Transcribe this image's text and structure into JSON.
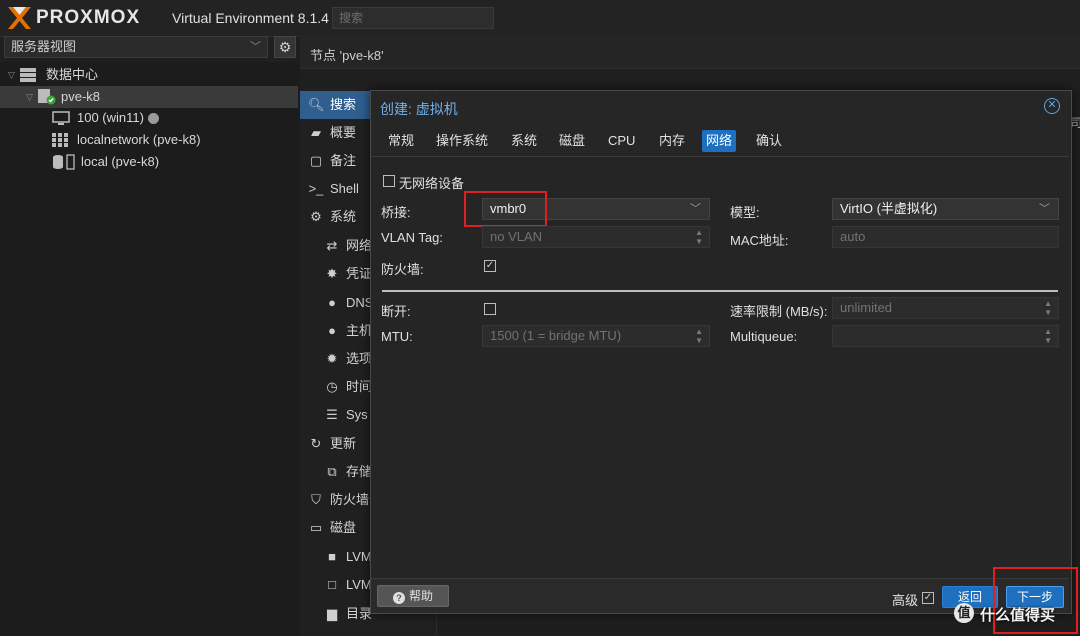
{
  "topbar": {
    "logo_text": "PROXMOX",
    "product": "Virtual Environment 8.1.4",
    "search_placeholder": "搜索"
  },
  "tree": {
    "view_select": "服务器视图",
    "items": [
      {
        "label": "数据中心"
      },
      {
        "label": "pve-k8"
      },
      {
        "label": "100 (win11)"
      },
      {
        "label": "localnetwork (pve-k8)"
      },
      {
        "label": "local (pve-k8)"
      }
    ]
  },
  "main": {
    "node_title": "节点 'pve-k8'",
    "right_edge_text": "司"
  },
  "node_nav": [
    {
      "label": "搜索",
      "icon": "search-icon"
    },
    {
      "label": "概要",
      "icon": "book-icon"
    },
    {
      "label": "备注",
      "icon": "note-icon"
    },
    {
      "label": "Shell",
      "icon": "terminal-icon"
    },
    {
      "label": "系统",
      "icon": "gears-icon"
    },
    {
      "label": "网络",
      "icon": "exchange-icon"
    },
    {
      "label": "凭证",
      "icon": "certificate-icon"
    },
    {
      "label": "DNS",
      "icon": "globe-icon"
    },
    {
      "label": "主机",
      "icon": "globe-icon"
    },
    {
      "label": "选项",
      "icon": "gear-icon"
    },
    {
      "label": "时间",
      "icon": "clock-icon"
    },
    {
      "label": "Sys",
      "icon": "list-icon"
    },
    {
      "label": "更新",
      "icon": "refresh-icon"
    },
    {
      "label": "存储",
      "icon": "files-icon"
    },
    {
      "label": "防火墙",
      "icon": "shield-icon"
    },
    {
      "label": "磁盘",
      "icon": "hdd-icon"
    },
    {
      "label": "LVM",
      "icon": "square-icon"
    },
    {
      "label": "LVM",
      "icon": "square-outline-icon"
    },
    {
      "label": "目录",
      "icon": "folder-icon"
    }
  ],
  "dialog": {
    "title": "创建: 虚拟机",
    "tabs": [
      "常规",
      "操作系统",
      "系统",
      "磁盘",
      "CPU",
      "内存",
      "网络",
      "确认"
    ],
    "active_tab": "网络",
    "no_network": {
      "label": "无网络设备",
      "checked": false
    },
    "bridge": {
      "label": "桥接:",
      "value": "vmbr0"
    },
    "model": {
      "label": "模型:",
      "value": "VirtIO (半虚拟化)"
    },
    "vlan": {
      "label": "VLAN Tag:",
      "placeholder": "no VLAN"
    },
    "mac": {
      "label": "MAC地址:",
      "placeholder": "auto"
    },
    "firewall": {
      "label": "防火墙:",
      "checked": true
    },
    "disconnect": {
      "label": "断开:",
      "checked": false
    },
    "rate": {
      "label": "速率限制 (MB/s):",
      "placeholder": "unlimited"
    },
    "mtu": {
      "label": "MTU:",
      "placeholder": "1500 (1 = bridge MTU)"
    },
    "multiqueue": {
      "label": "Multiqueue:",
      "value": ""
    },
    "footer": {
      "help": "帮助",
      "advanced": "高级",
      "advanced_checked": true,
      "back": "返回",
      "next": "下一步"
    }
  },
  "watermark": "值 什么值得买",
  "colors": {
    "accent": "#1f6fbf",
    "highlight": "#e02020",
    "title_blue": "#6fb1ec"
  }
}
